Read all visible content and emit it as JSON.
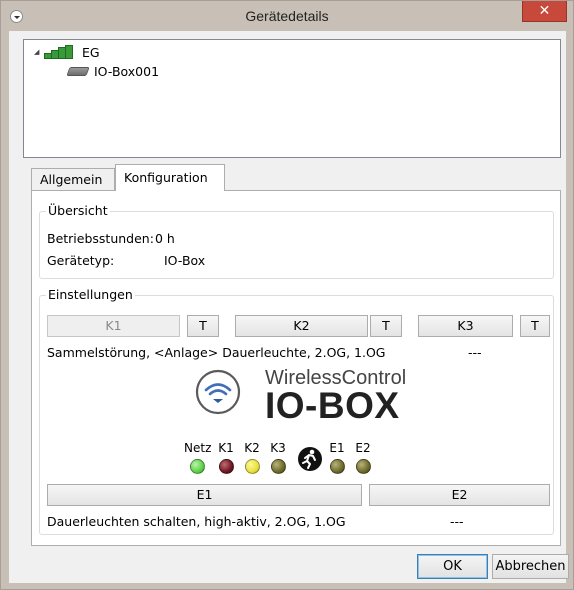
{
  "window": {
    "title": "Gerätedetails",
    "close_glyph": "✕"
  },
  "tree": {
    "root": {
      "label": "EG",
      "icon": "building-floor-icon"
    },
    "child": {
      "label": "IO-Box001",
      "icon": "io-box-device-icon"
    }
  },
  "tabs": [
    {
      "label": "Allgemein",
      "active": false
    },
    {
      "label": "Konfiguration",
      "active": true
    }
  ],
  "overview": {
    "title": "Übersicht",
    "hours_label": "Betriebsstunden:",
    "hours_value": "0 h",
    "type_label": "Gerätetyp:",
    "type_value": "IO-Box"
  },
  "settings": {
    "title": "Einstellungen",
    "outputs": [
      {
        "label": "K1",
        "enabled": false,
        "test_label": "T"
      },
      {
        "label": "K2",
        "enabled": true,
        "test_label": "T"
      },
      {
        "label": "K3",
        "enabled": true,
        "test_label": "T"
      }
    ],
    "outputs_desc": "Sammelstörung, <Anlage> Dauerleuchte, 2.OG, 1.OG",
    "outputs_desc_k3": "---",
    "logo": {
      "line1": "WirelessControl",
      "line2": "IO-BOX"
    },
    "leds": [
      {
        "label": "Netz",
        "color": "#5fd14a"
      },
      {
        "label": "K1",
        "color": "#6b1a22"
      },
      {
        "label": "K2",
        "color": "#e8e23c"
      },
      {
        "label": "K3",
        "color": "#6e6b2c"
      },
      {
        "label": "",
        "icon": "emergency-exit-icon"
      },
      {
        "label": "E1",
        "color": "#6e6b2c"
      },
      {
        "label": "E2",
        "color": "#6e6b2c"
      }
    ],
    "inputs": [
      {
        "label": "E1"
      },
      {
        "label": "E2"
      }
    ],
    "inputs_desc": "Dauerleuchten schalten, high-aktiv, 2.OG, 1.OG",
    "inputs_desc_e2": "---"
  },
  "footer": {
    "ok_label": "OK",
    "cancel_label": "Abbrechen"
  }
}
